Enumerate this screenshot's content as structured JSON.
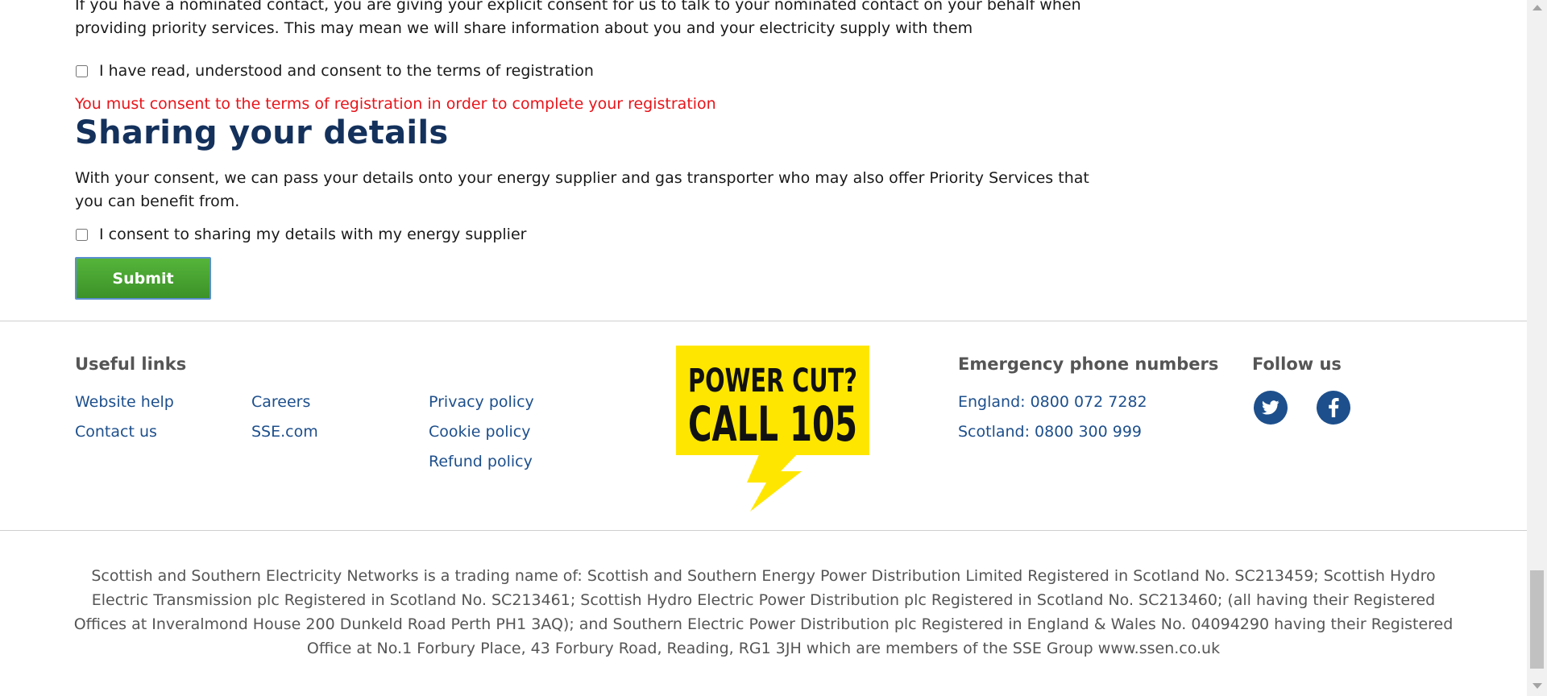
{
  "consent": {
    "intro_text": "If you have a nominated contact, you are giving your explicit consent for us to talk to your nominated contact on your behalf when providing priority services. This may mean we will share information about you and your electricity supply with them",
    "terms_label": "I have read, understood and consent to the terms of registration",
    "terms_error": "You must consent to the terms of registration in order to complete your registration"
  },
  "sharing": {
    "heading": "Sharing your details",
    "text": "With your consent, we can pass your details onto your energy supplier and gas transporter who may also offer Priority Services that you can benefit from.",
    "checkbox_label": "I consent to sharing my details with my energy supplier"
  },
  "form": {
    "submit_label": "Submit"
  },
  "footer": {
    "useful_links_title": "Useful links",
    "links": {
      "website_help": "Website help",
      "contact_us": "Contact us",
      "careers": "Careers",
      "sse_com": "SSE.com",
      "privacy": "Privacy policy",
      "cookie": "Cookie policy",
      "refund": "Refund policy"
    },
    "power_cut": {
      "line1": "POWER CUT?",
      "line2": "CALL 105"
    },
    "emergency_title": "Emergency phone numbers",
    "emergency": {
      "england": "England: 0800 072 7282",
      "scotland": "Scotland: 0800 300 999"
    },
    "follow_title": "Follow us",
    "social_icons": [
      "twitter-icon",
      "facebook-icon"
    ],
    "social_color": "#1d4f8c",
    "legal_text": "Scottish and Southern Electricity Networks is a trading name of: Scottish and Southern Energy Power Distribution Limited Registered in Scotland No. SC213459; Scottish Hydro Electric Transmission plc Registered in Scotland No. SC213461; Scottish Hydro Electric Power Distribution plc Registered in Scotland No. SC213460; (all having their Registered Offices at Inveralmond House 200 Dunkeld Road Perth PH1 3AQ); and Southern Electric Power Distribution plc Registered in England & Wales No. 04094290 having their Registered Office at No.1 Forbury Place, 43 Forbury Road, Reading, RG1 3JH which are members of the SSE Group www.ssen.co.uk"
  },
  "colors": {
    "heading": "#14315c",
    "error": "#e8141a",
    "link": "#1d4f8c",
    "submit": "#4aa334",
    "power_cut_bg": "#ffe600"
  }
}
